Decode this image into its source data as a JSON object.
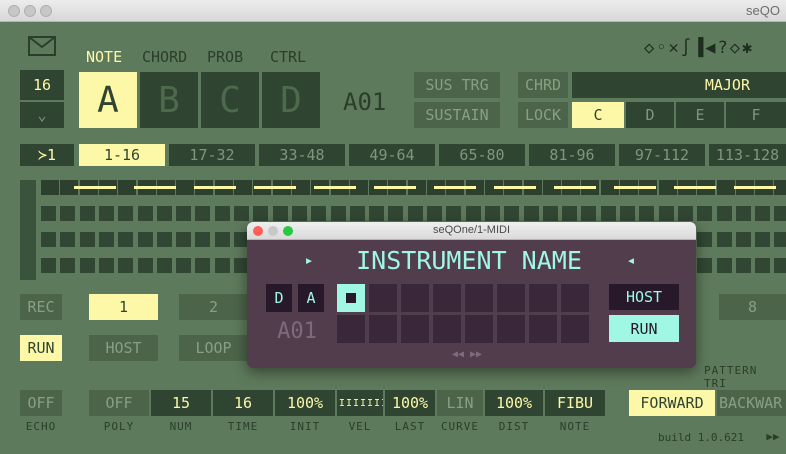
{
  "window": {
    "title": "seQO"
  },
  "popup": {
    "title": "seQOne/1-MIDI",
    "instrument_name": "INSTRUMENT NAME",
    "mode_d": "D",
    "mode_a": "A",
    "track_id": "A01",
    "host_label": "HOST",
    "run_label": "RUN",
    "nav_arrows": "◀◀ ▶▶"
  },
  "header": {
    "track_tabs": [
      "NOTE",
      "CHORD",
      "PROB",
      "CTRL"
    ],
    "pattern_letters": [
      "A",
      "B",
      "C",
      "D"
    ],
    "pattern_id": "A01",
    "length_value": "16",
    "sus_trg": "SUS TRG",
    "sustain": "SUSTAIN",
    "chrd": "CHRD",
    "chord_type": "MAJOR",
    "lock": "LOCK",
    "keys": [
      "C",
      "D",
      "E",
      "F"
    ],
    "toolbar_icons": [
      "◇",
      "◦",
      "✕",
      "∫",
      "▐◀",
      "?",
      "◇",
      "✱"
    ]
  },
  "page_tabs": [
    "≻1",
    "1-16",
    "17-32",
    "33-48",
    "49-64",
    "65-80",
    "81-96",
    "97-112",
    "113-128"
  ],
  "controls": {
    "rec": "REC",
    "run": "RUN",
    "host": "HOST",
    "loop": "LOOP",
    "pattern_buttons": [
      "1",
      "2",
      "8"
    ],
    "pattern_label": "PATTERN TRI"
  },
  "bottom_params": {
    "values": [
      "OFF",
      "OFF",
      "15",
      "16",
      "100%",
      "",
      "100%",
      "LIN",
      "100%",
      "FIBU"
    ],
    "labels": [
      "ECHO",
      "POLY",
      "NUM",
      "TIME",
      "INIT",
      "VEL",
      "LAST",
      "CURVE",
      "DIST",
      "NOTE"
    ],
    "forward": "FORWARD",
    "backward": "BACKWAR"
  },
  "build": "build 1.0.621",
  "colors": {
    "background": "#5e7a5c",
    "panel": "#2f4431",
    "highlight": "#fdf8a8",
    "popup_bg": "#513d4c",
    "popup_text": "#9ff7e4"
  }
}
